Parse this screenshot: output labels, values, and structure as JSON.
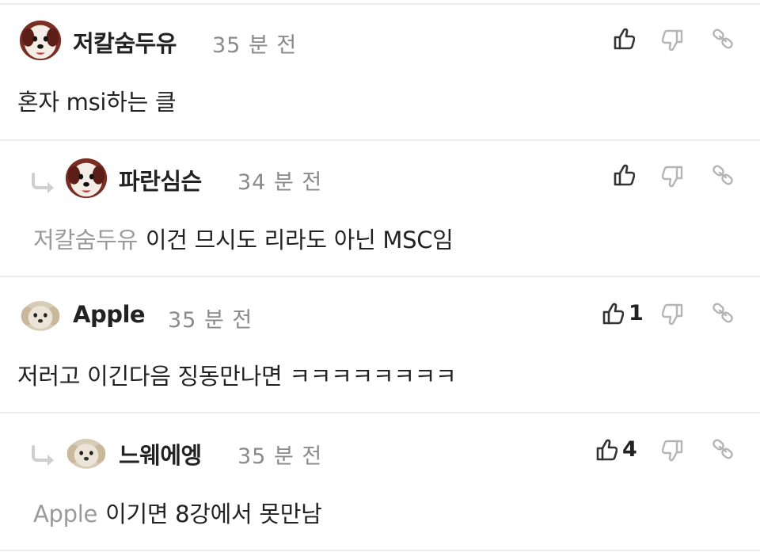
{
  "comments": [
    {
      "username": "저칼숨두유",
      "time": "35 분 전",
      "text": "혼자 msi하는 클",
      "mention": "",
      "likes": "",
      "is_reply": false
    },
    {
      "username": "파란심슨",
      "time": "34 분 전",
      "text": "이건 므시도 리라도 아닌 MSC임",
      "mention": "저칼숨두유",
      "likes": "",
      "is_reply": true
    },
    {
      "username": "Apple",
      "time": "35 분 전",
      "text": "저러고 이긴다음 징동만나면 ㅋㅋㅋㅋㅋㅋㅋㅋ",
      "mention": "",
      "likes": "1",
      "is_reply": false
    },
    {
      "username": "느웨에엥",
      "time": "35 분 전",
      "text": "이기면 8강에서 못만남",
      "mention": "Apple",
      "likes": "4",
      "is_reply": true
    }
  ],
  "icons": {
    "like": "thumbs-up-icon",
    "dislike": "thumbs-down-icon",
    "link": "link-icon",
    "reply": "reply-arrow-icon",
    "avatar": "dog-avatar-icon"
  },
  "colors": {
    "text": "#222222",
    "muted": "#8a8a8a",
    "mention": "#9a9a9a",
    "icon_dark": "#333333",
    "icon_light": "#b5b5b5",
    "divider": "#ececec"
  }
}
